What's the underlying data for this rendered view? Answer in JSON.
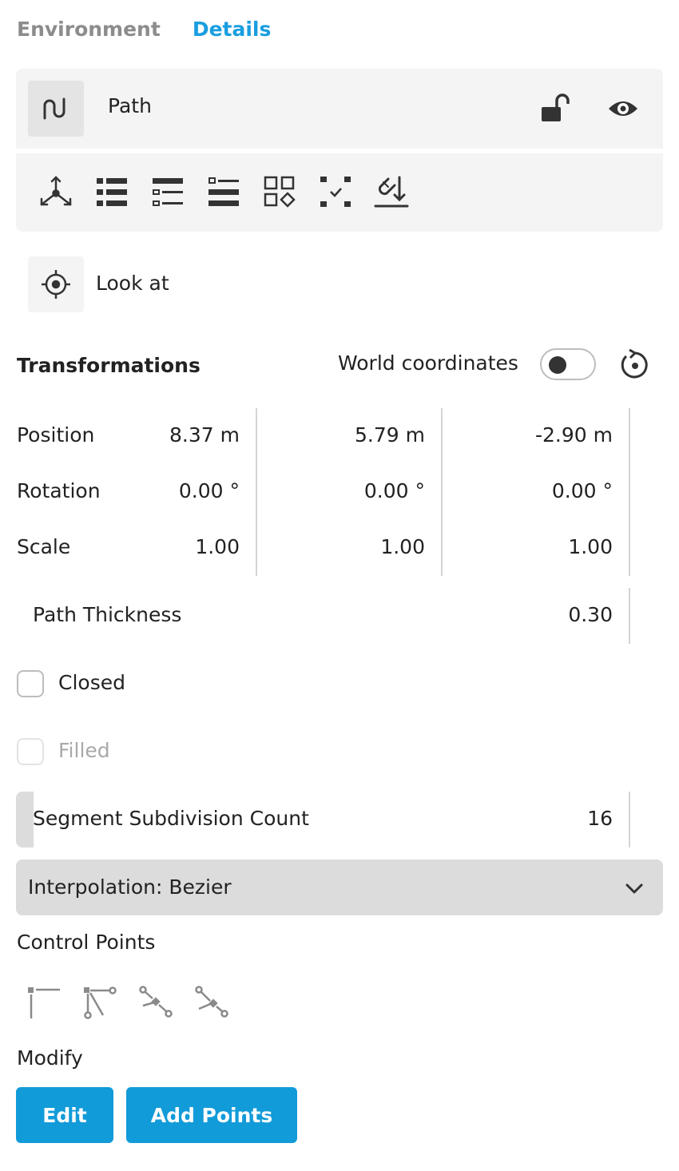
{
  "tabs": [
    {
      "label": "Environment",
      "active": false
    },
    {
      "label": "Details",
      "active": true
    }
  ],
  "object": {
    "name": "Path",
    "icon": "path-icon"
  },
  "header_icons": [
    "unlock-icon",
    "eye-icon"
  ],
  "tools": [
    "transform-gizmo-icon",
    "list-icon",
    "list-outline-icon",
    "checklist-icon",
    "grid-shapes-icon",
    "select-points-icon",
    "snap-down-icon"
  ],
  "look_at": {
    "label": "Look at",
    "icon": "crosshair-icon"
  },
  "transformations": {
    "title": "Transformations",
    "world_coordinates_label": "World coordinates",
    "world_coordinates_on": false,
    "rows": [
      {
        "label": "Position",
        "values": [
          "8.37 m",
          "5.79 m",
          "-2.90 m"
        ]
      },
      {
        "label": "Rotation",
        "values": [
          "0.00 °",
          "0.00 °",
          "0.00 °"
        ]
      },
      {
        "label": "Scale",
        "values": [
          "1.00",
          "1.00",
          "1.00"
        ]
      }
    ]
  },
  "path_thickness": {
    "label": "Path Thickness",
    "value": "0.30"
  },
  "closed": {
    "label": "Closed",
    "checked": false
  },
  "filled": {
    "label": "Filled",
    "checked": false,
    "disabled": true
  },
  "segment_subdivision": {
    "label": "Segment Subdivision Count",
    "value": "16"
  },
  "interpolation": {
    "label": "Interpolation: Bezier"
  },
  "control_points": {
    "title": "Control Points",
    "tools": [
      "corner-point-icon",
      "bezier-point-icon",
      "smooth-handle-icon",
      "aligned-handle-icon"
    ]
  },
  "modify": {
    "title": "Modify",
    "edit_label": "Edit",
    "add_points_label": "Add Points"
  },
  "colors": {
    "accent": "#1a9ee0",
    "button": "#129bd9",
    "panel": "#f4f4f4",
    "dropdown": "#dcdcdc"
  }
}
